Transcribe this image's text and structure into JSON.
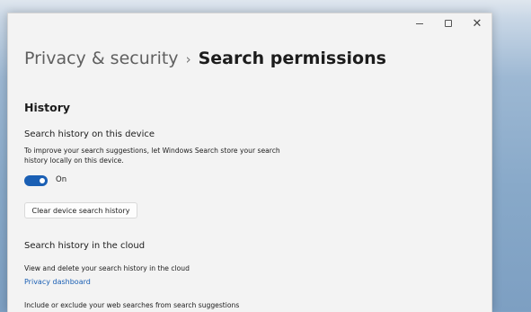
{
  "window": {
    "controls": {
      "minimize": "–",
      "maximize": "□",
      "close": "✕"
    }
  },
  "breadcrumb": {
    "parent": "Privacy & security",
    "separator": "›",
    "current": "Search permissions"
  },
  "history": {
    "heading": "History",
    "device": {
      "title": "Search history on this device",
      "description": "To improve your search suggestions, let Windows Search store your search history locally on this device.",
      "toggle_state": "On",
      "toggle_on": true,
      "clear_button": "Clear device search history"
    },
    "cloud": {
      "title": "Search history in the cloud",
      "description": "View and delete your search history in the cloud",
      "link": "Privacy dashboard",
      "include_text": "Include or exclude your web searches from search suggestions"
    }
  },
  "colors": {
    "accent": "#1a5fb4",
    "window_bg": "#f3f3f3",
    "desktop": "#88a9c9"
  }
}
